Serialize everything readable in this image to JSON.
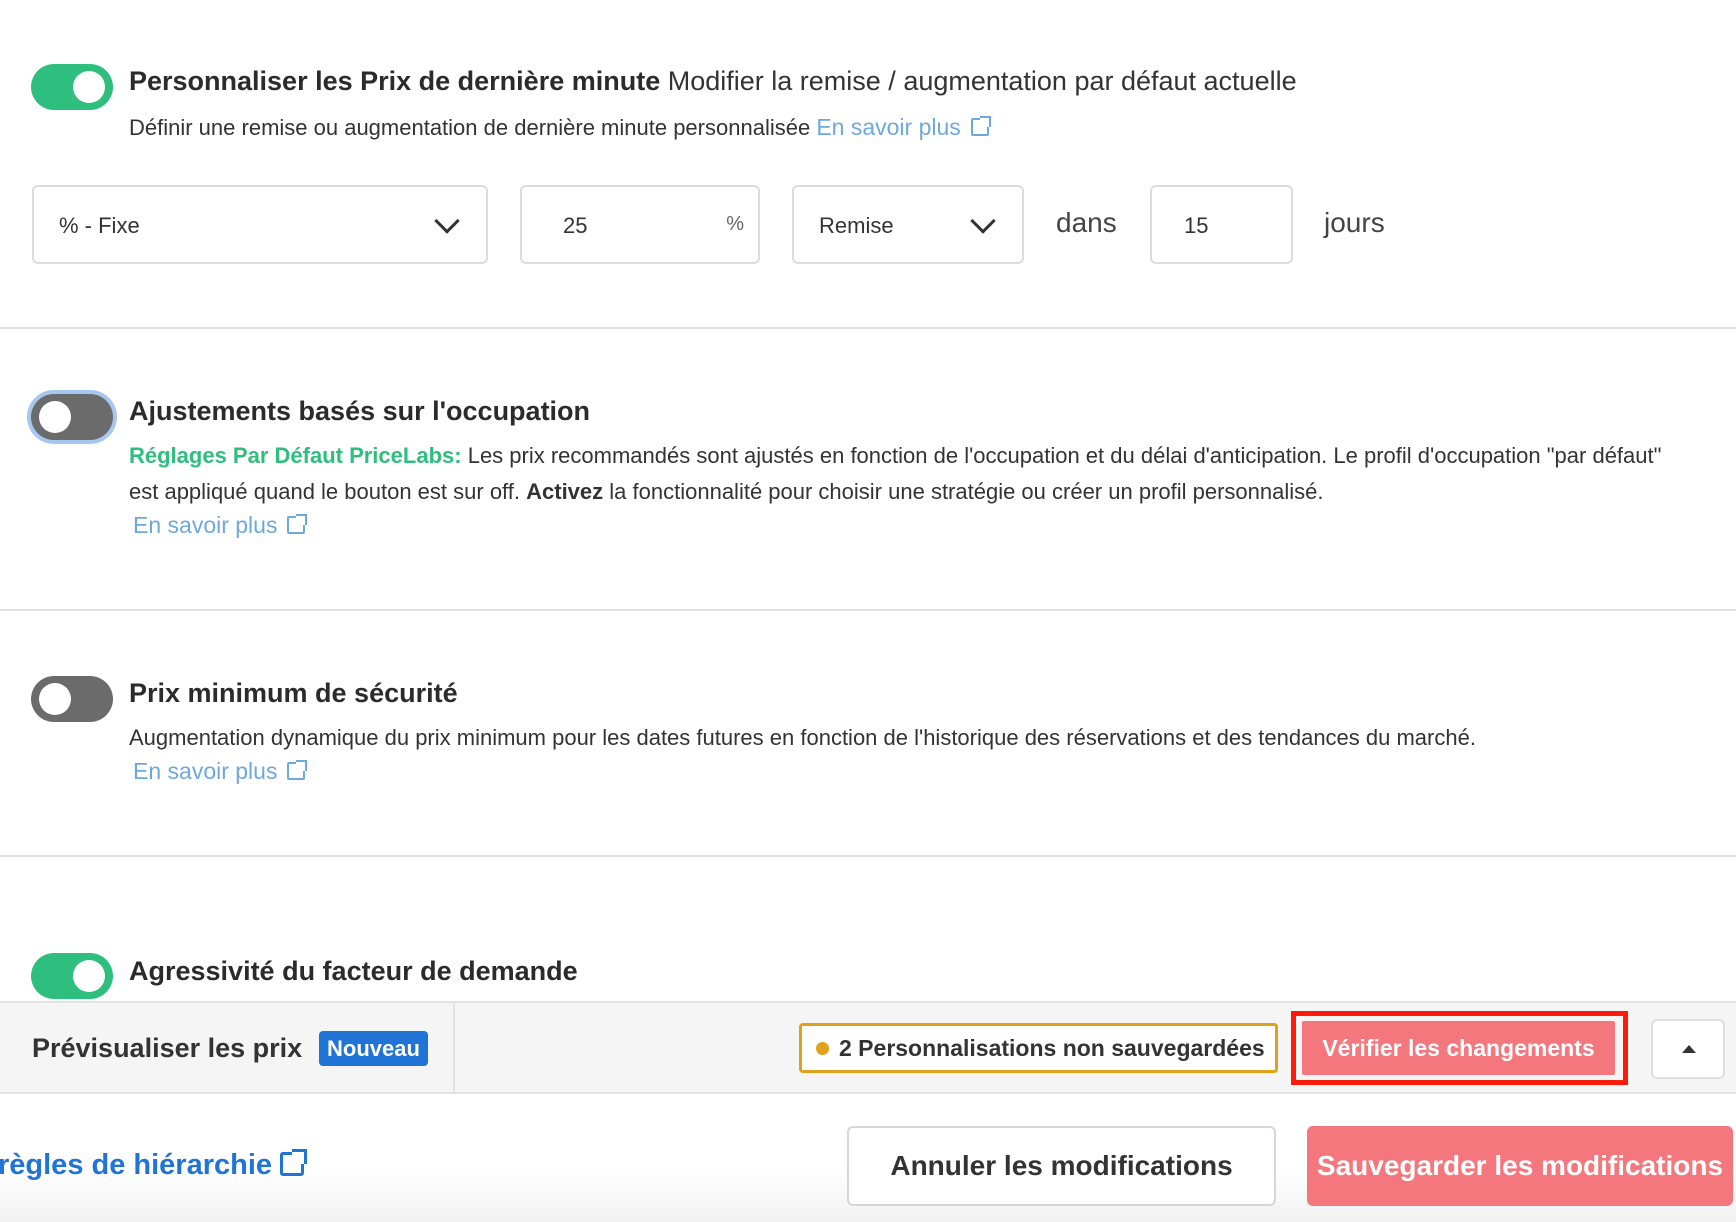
{
  "last_minute": {
    "title": "Personnaliser les Prix de dernière minute",
    "subtitle": "Modifier la remise / augmentation par défaut actuelle",
    "description": "Définir une remise ou augmentation de dernière minute personnalisée",
    "learn_more": "En savoir plus",
    "enabled": true,
    "type_select": "% - Fixe",
    "amount": "25",
    "amount_unit": "%",
    "direction_select": "Remise",
    "within_label": "dans",
    "days_value": "15",
    "days_label": "jours"
  },
  "occupancy": {
    "title": "Ajustements basés sur l'occupation",
    "enabled": false,
    "default_label": "Réglages Par Défaut PriceLabs:",
    "description_1": "Les prix recommandés sont ajustés en fonction de l'occupation et du délai d'anticipation. Le profil d'occupation \"par défaut\" est appliqué quand le bouton est sur off.",
    "activate_word": "Activez",
    "description_2": "la fonctionnalité pour choisir une stratégie ou créer un profil personnalisé.",
    "learn_more": "En savoir plus"
  },
  "min_safety": {
    "title": "Prix minimum de sécurité",
    "enabled": false,
    "description": "Augmentation dynamique du prix minimum pour les dates futures en fonction de l'historique des réservations et des tendances du marché.",
    "learn_more": "En savoir plus"
  },
  "demand": {
    "title": "Agressivité du facteur de demande",
    "enabled": true
  },
  "bottom_bar": {
    "preview_label": "Prévisualiser les prix",
    "new_badge": "Nouveau",
    "unsaved": "2 Personnalisations non sauvegardées",
    "verify_button": "Vérifier les changements"
  },
  "footer": {
    "hierarchy_link": "règles de hiérarchie",
    "cancel_button": "Annuler les modifications",
    "save_button": "Sauvegarder les modifications"
  },
  "colors": {
    "toggle_on": "#2ebf7f",
    "toggle_off": "#6b6b6b",
    "link": "#6fa8dc",
    "primary_blue": "#1f74d6",
    "warning": "#e0a11b",
    "save_button": "#f4777d",
    "highlight_box": "#ff1a0a"
  }
}
